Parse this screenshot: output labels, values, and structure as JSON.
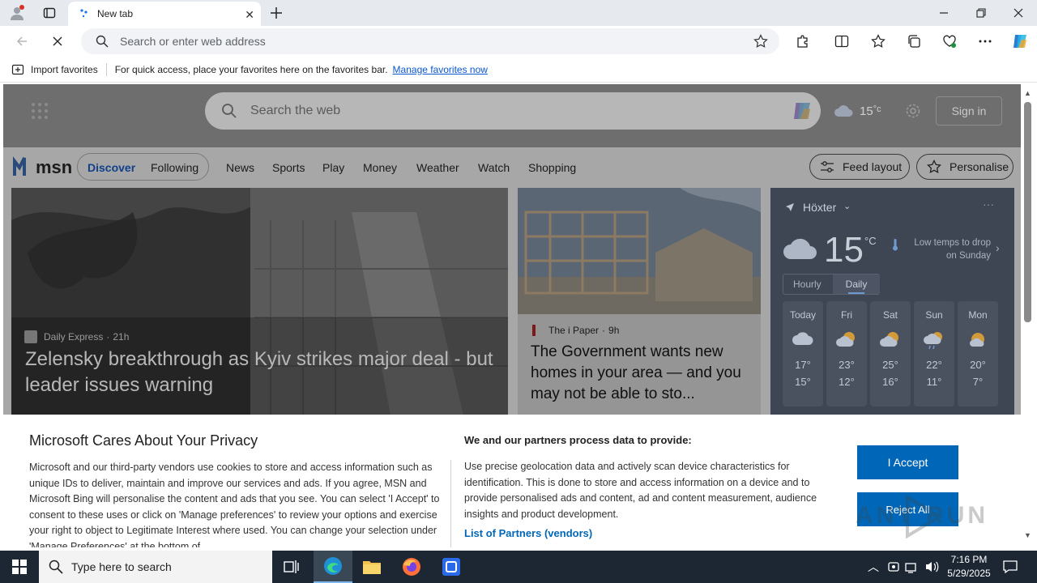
{
  "browser": {
    "tab_title": "New tab",
    "address_placeholder": "Search or enter web address"
  },
  "favorites_bar": {
    "import_label": "Import favorites",
    "hint_text": "For quick access, place your favorites here on the favorites bar.",
    "manage_link": "Manage favorites now"
  },
  "msn": {
    "search_placeholder": "Search the web",
    "header_temp": "15",
    "header_temp_unit": "°c",
    "signin_label": "Sign in",
    "logo_text": "msn",
    "nav_tabs": [
      {
        "label": "Discover"
      },
      {
        "label": "Following"
      }
    ],
    "nav_links": [
      {
        "label": "News"
      },
      {
        "label": "Sports"
      },
      {
        "label": "Play"
      },
      {
        "label": "Money"
      },
      {
        "label": "Weather"
      },
      {
        "label": "Watch"
      },
      {
        "label": "Shopping"
      }
    ],
    "feed_layout_label": "Feed layout",
    "personalise_label": "Personalise"
  },
  "cards": {
    "main": {
      "source": "Daily Express",
      "age": "21h",
      "headline": "Zelensky breakthrough as Kyiv strikes major deal - but leader issues warning"
    },
    "secondary": {
      "source": "The i Paper",
      "age": "9h",
      "headline": "The Government wants new homes in your area — and you may not be able to sto..."
    }
  },
  "weather": {
    "location": "Höxter",
    "temp": "15",
    "unit": "°C",
    "alert_line1": "Low temps to drop",
    "alert_line2": "on Sunday",
    "tabs": [
      "Hourly",
      "Daily"
    ],
    "days": [
      {
        "name": "Today",
        "high": "17°",
        "low": "15°",
        "icon": "cloud-icon"
      },
      {
        "name": "Fri",
        "high": "23°",
        "low": "12°",
        "icon": "partly-sunny-icon"
      },
      {
        "name": "Sat",
        "high": "25°",
        "low": "16°",
        "icon": "partly-sunny-icon"
      },
      {
        "name": "Sun",
        "high": "22°",
        "low": "11°",
        "icon": "rain-cloud-icon"
      },
      {
        "name": "Mon",
        "high": "20°",
        "low": "7°",
        "icon": "partly-sunny-icon"
      }
    ]
  },
  "privacy": {
    "title": "Microsoft Cares About Your Privacy",
    "body": "Microsoft and our third-party vendors use cookies to store and access information such as unique IDs to deliver, maintain and improve our services and ads. If you agree, MSN and Microsoft Bing will personalise the content and ads that you see. You can select 'I Accept' to consent to these uses or click on 'Manage preferences' to review your options and exercise your right to object to Legitimate Interest where used. You can change your selection under 'Manage Preferences' at the bottom of",
    "partners_heading": "We and our partners process data to provide:",
    "partners_body": "Use precise geolocation data and actively scan device characteristics for identification. This is done to store and access information on a device and to provide personalised ads and content, ad and content measurement, audience insights and product development.",
    "partners_link": "List of Partners (vendors)",
    "accept_label": "I Accept",
    "reject_label": "Reject All"
  },
  "watermark": "ANY RUN",
  "taskbar": {
    "search_placeholder": "Type here to search",
    "time": "7:16 PM",
    "date": "5/29/2025"
  },
  "colors": {
    "accent": "#0067b8",
    "link": "#0b57d0",
    "taskbar": "#1c2733"
  }
}
